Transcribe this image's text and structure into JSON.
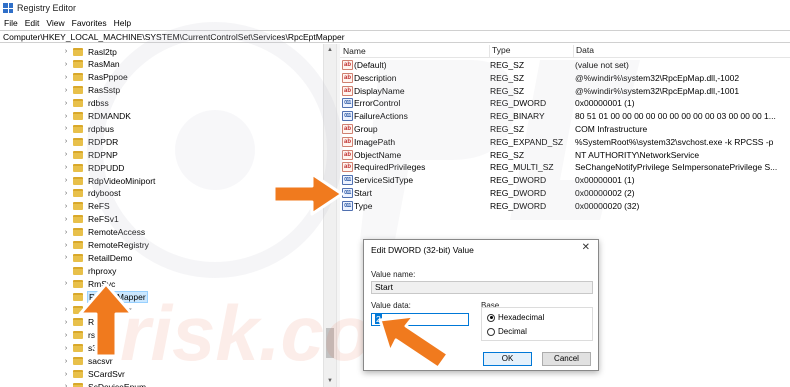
{
  "window": {
    "title": "Registry Editor"
  },
  "menu": [
    "File",
    "Edit",
    "View",
    "Favorites",
    "Help"
  ],
  "address": "Computer\\HKEY_LOCAL_MACHINE\\SYSTEM\\CurrentControlSet\\Services\\RpcEptMapper",
  "tree": {
    "items": [
      {
        "label": "Rasl2tp",
        "expandable": true
      },
      {
        "label": "RasMan",
        "expandable": true
      },
      {
        "label": "RasPppoe",
        "expandable": true
      },
      {
        "label": "RasSstp",
        "expandable": true
      },
      {
        "label": "rdbss",
        "expandable": true
      },
      {
        "label": "RDMANDK",
        "expandable": true
      },
      {
        "label": "rdpbus",
        "expandable": true
      },
      {
        "label": "RDPDR",
        "expandable": true
      },
      {
        "label": "RDPNP",
        "expandable": true
      },
      {
        "label": "RDPUDD",
        "expandable": true
      },
      {
        "label": "RdpVideoMiniport",
        "expandable": true
      },
      {
        "label": "rdyboost",
        "expandable": true
      },
      {
        "label": "ReFS",
        "expandable": true
      },
      {
        "label": "ReFSv1",
        "expandable": true
      },
      {
        "label": "RemoteAccess",
        "expandable": true
      },
      {
        "label": "RemoteRegistry",
        "expandable": true
      },
      {
        "label": "RetailDemo",
        "expandable": true
      },
      {
        "label": "rhproxy",
        "expandable": false
      },
      {
        "label": "RmSvc",
        "expandable": true
      },
      {
        "label": "RpcEptMapper",
        "expandable": false,
        "selected": true
      },
      {
        "label": "RpcLocator",
        "expandable": true
      },
      {
        "label": "RpcSs",
        "expandable": true
      },
      {
        "label": "rspndr",
        "expandable": true
      },
      {
        "label": "s3cap",
        "expandable": true
      },
      {
        "label": "sacsvr",
        "expandable": true
      },
      {
        "label": "SCardSvr",
        "expandable": true
      },
      {
        "label": "ScDeviceEnum",
        "expandable": true
      }
    ]
  },
  "list": {
    "headers": {
      "name": "Name",
      "type": "Type",
      "data": "Data"
    },
    "rows": [
      {
        "icon": "ab",
        "name": "(Default)",
        "type": "REG_SZ",
        "data": "(value not set)"
      },
      {
        "icon": "ab",
        "name": "Description",
        "type": "REG_SZ",
        "data": "@%windir%\\system32\\RpcEpMap.dll,-1002"
      },
      {
        "icon": "ab",
        "name": "DisplayName",
        "type": "REG_SZ",
        "data": "@%windir%\\system32\\RpcEpMap.dll,-1001"
      },
      {
        "icon": "bin",
        "name": "ErrorControl",
        "type": "REG_DWORD",
        "data": "0x00000001 (1)"
      },
      {
        "icon": "bin",
        "name": "FailureActions",
        "type": "REG_BINARY",
        "data": "80 51 01 00 00 00 00 00 00 00 00 00 03 00 00 00 1..."
      },
      {
        "icon": "ab",
        "name": "Group",
        "type": "REG_SZ",
        "data": "COM Infrastructure"
      },
      {
        "icon": "ab",
        "name": "ImagePath",
        "type": "REG_EXPAND_SZ",
        "data": "%SystemRoot%\\system32\\svchost.exe -k RPCSS -p"
      },
      {
        "icon": "ab",
        "name": "ObjectName",
        "type": "REG_SZ",
        "data": "NT AUTHORITY\\NetworkService"
      },
      {
        "icon": "ab",
        "name": "RequiredPrivileges",
        "type": "REG_MULTI_SZ",
        "data": "SeChangeNotifyPrivilege SeImpersonatePrivilege S..."
      },
      {
        "icon": "bin",
        "name": "ServiceSidType",
        "type": "REG_DWORD",
        "data": "0x00000001 (1)"
      },
      {
        "icon": "bin",
        "name": "Start",
        "type": "REG_DWORD",
        "data": "0x00000002 (2)"
      },
      {
        "icon": "bin",
        "name": "Type",
        "type": "REG_DWORD",
        "data": "0x00000020 (32)"
      }
    ]
  },
  "dialog": {
    "title": "Edit DWORD (32-bit) Value",
    "close": "✕",
    "value_name_label": "Value name:",
    "value_name": "Start",
    "value_data_label": "Value data:",
    "value_data": "2",
    "base_label": "Base",
    "radio_hex": "Hexadecimal",
    "radio_dec": "Decimal",
    "base_selected": "Hexadecimal",
    "ok": "OK",
    "cancel": "Cancel"
  },
  "annotations": {
    "arrow_color": "#f07a1e"
  },
  "icons": {
    "app": "registry-icon",
    "expander": "chevron-right-icon"
  }
}
